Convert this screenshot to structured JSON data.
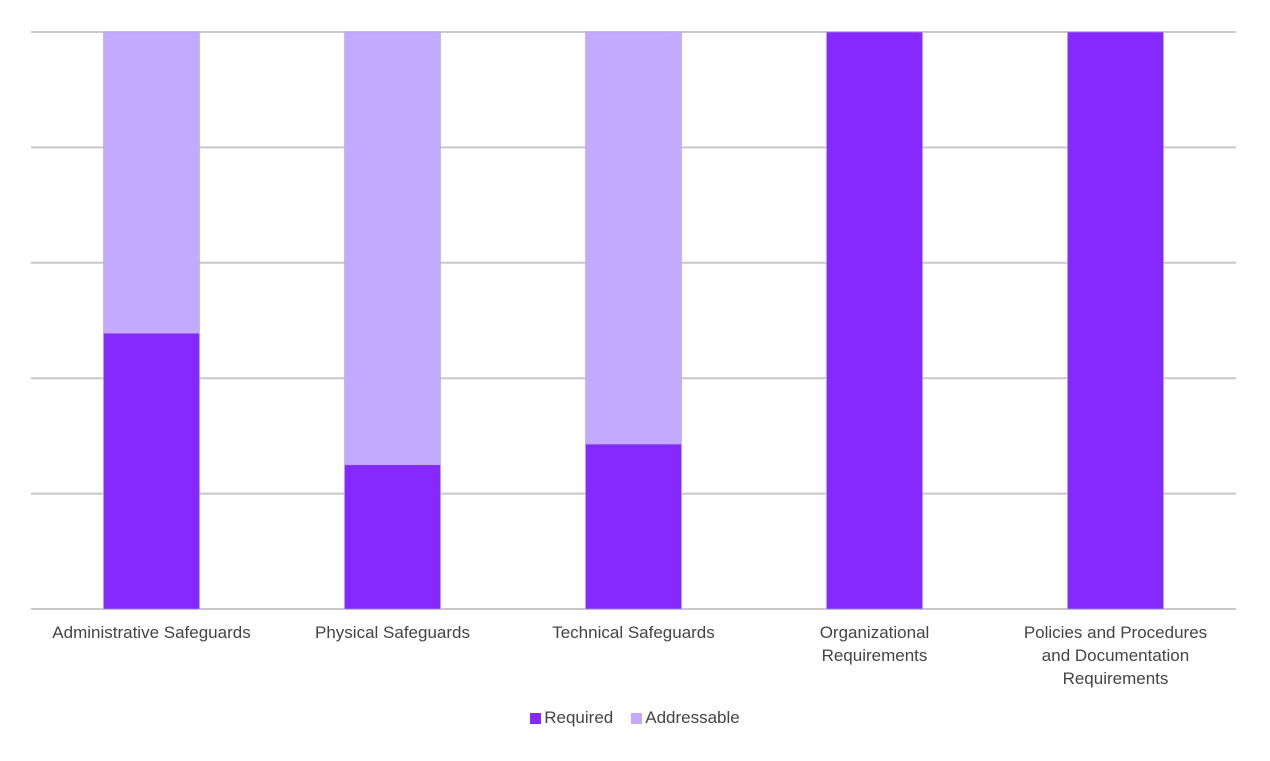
{
  "chart_data": {
    "type": "bar",
    "stacked": true,
    "normalized": true,
    "title": "",
    "xlabel": "",
    "ylabel": "",
    "ylim": [
      0,
      100
    ],
    "y_unit": "percent",
    "grid": true,
    "gridline_values": [
      0,
      20,
      40,
      60,
      80,
      100
    ],
    "y_tick_labels_shown": false,
    "categories": [
      "Administrative Safeguards",
      "Physical Safeguards",
      "Technical Safeguards",
      "Organizational Requirements",
      "Policies and Procedures and Documentation Requirements"
    ],
    "category_label_lines": [
      [
        "Administrative Safeguards"
      ],
      [
        "Physical Safeguards"
      ],
      [
        "Technical Safeguards"
      ],
      [
        "Organizational",
        "Requirements"
      ],
      [
        "Policies and Procedures",
        "and Documentation",
        "Requirements"
      ]
    ],
    "series": [
      {
        "name": "Required",
        "color": "#8629ff",
        "values": [
          47.8,
          25.0,
          28.6,
          100,
          100
        ]
      },
      {
        "name": "Addressable",
        "color": "#c3aaff",
        "values": [
          52.2,
          75.0,
          71.4,
          0,
          0
        ]
      }
    ],
    "legend": {
      "position": "bottom",
      "entries": [
        "Required",
        "Addressable"
      ]
    }
  }
}
